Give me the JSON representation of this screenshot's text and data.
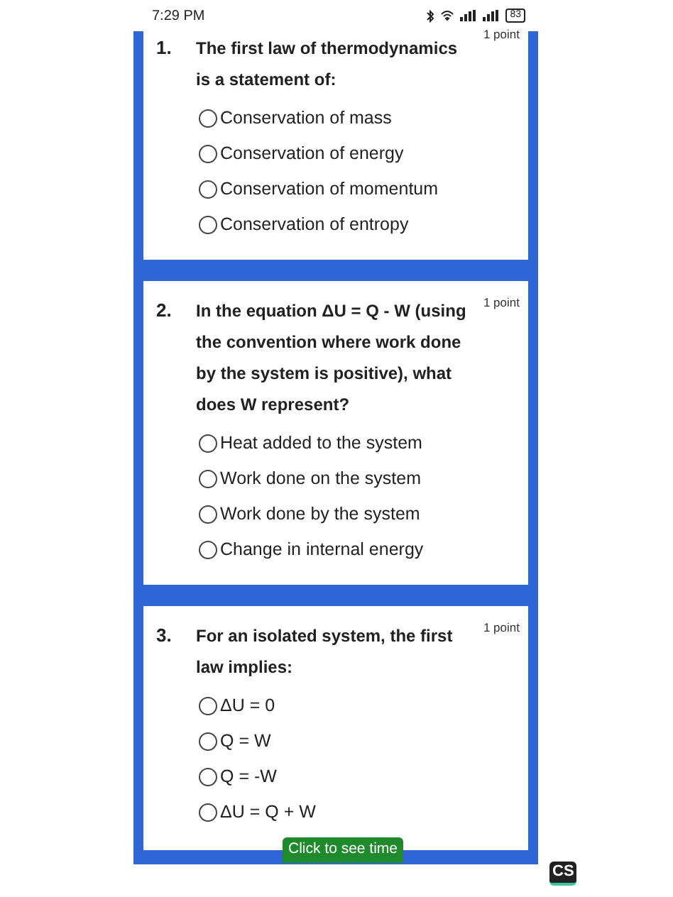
{
  "status_bar": {
    "time": "7:29 PM",
    "battery": "83"
  },
  "questions": [
    {
      "number": "1.",
      "text": "The first law of thermodynamics is a statement of:",
      "points": "1 point",
      "options": [
        {
          "label": "Conservation of mass",
          "selected": false
        },
        {
          "label": "Conservation of energy",
          "selected": false
        },
        {
          "label": "Conservation of momentum",
          "selected": false
        },
        {
          "label": "Conservation of entropy",
          "selected": false
        }
      ]
    },
    {
      "number": "2.",
      "text": "In the equation ΔU = Q - W (using the convention where work done by the system is positive), what does W represent?",
      "points": "1 point",
      "options": [
        {
          "label": "Heat added to the system",
          "selected": false
        },
        {
          "label": "Work done on the system",
          "selected": false
        },
        {
          "label": "Work done by the system",
          "selected": false
        },
        {
          "label": "Change in internal energy",
          "selected": false
        }
      ]
    },
    {
      "number": "3.",
      "text": "For an isolated system, the first law implies:",
      "points": "1 point",
      "options": [
        {
          "label": "ΔU = 0",
          "selected": false
        },
        {
          "label": "Q = W",
          "selected": false
        },
        {
          "label": "Q = -W",
          "selected": false
        },
        {
          "label": "ΔU = Q + W",
          "selected": false
        }
      ]
    }
  ],
  "timer_button": "Click to see time",
  "app_badge": "CS"
}
